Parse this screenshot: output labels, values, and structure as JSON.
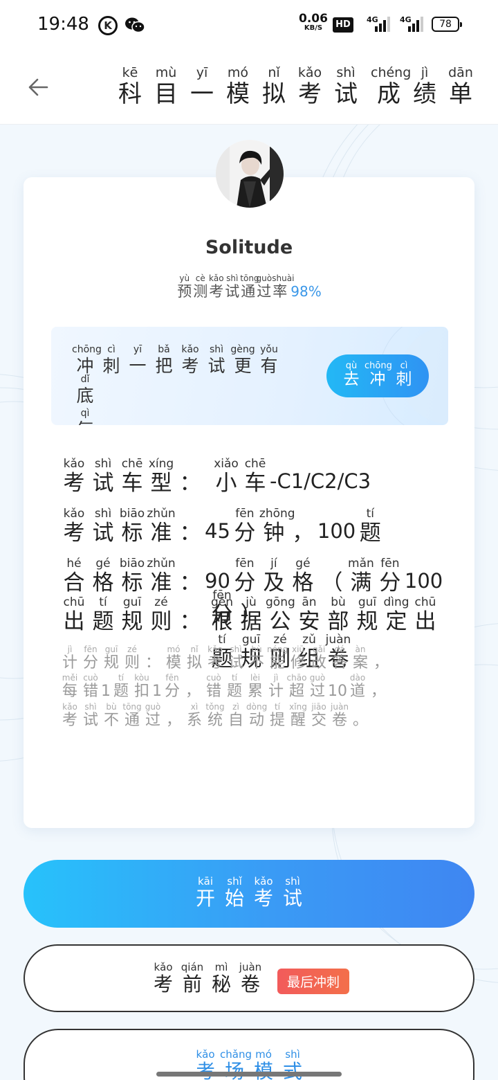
{
  "status_bar": {
    "time": "19:48",
    "speed_value": "0.06",
    "speed_unit": "KB/S",
    "hd_label": "HD",
    "signal1_label": "4G",
    "signal2_label": "4G",
    "battery": "78",
    "icons": [
      "k-icon",
      "wechat-icon",
      "signal-icon",
      "battery-icon"
    ]
  },
  "header": {
    "back_icon": "arrow-left-icon",
    "title": [
      {
        "c": "科",
        "p": "kē"
      },
      {
        "c": "目",
        "p": "mù"
      },
      {
        "c": "一",
        "p": "yī"
      },
      {
        "c": "模",
        "p": "mó"
      },
      {
        "c": "拟",
        "p": "nǐ"
      },
      {
        "c": "考",
        "p": "kǎo"
      },
      {
        "c": "试",
        "p": "shì"
      },
      {
        "c": "成",
        "p": "chéng"
      },
      {
        "c": "绩",
        "p": "jì"
      },
      {
        "c": "单",
        "p": "dān"
      }
    ]
  },
  "profile": {
    "username": "Solitude",
    "rate_label": [
      {
        "c": "预",
        "p": "yù"
      },
      {
        "c": "测",
        "p": "cè"
      },
      {
        "c": "考",
        "p": "kǎo"
      },
      {
        "c": "试",
        "p": "shì"
      },
      {
        "c": "通",
        "p": "tōng"
      },
      {
        "c": "过",
        "p": "guò"
      },
      {
        "c": "率",
        "p": "shuài"
      }
    ],
    "rate_value": "98%"
  },
  "sprint": {
    "line1": [
      {
        "c": "冲",
        "p": "chōng"
      },
      {
        "c": "刺",
        "p": "cì"
      },
      {
        "c": "一",
        "p": "yī"
      },
      {
        "c": "把",
        "p": "bǎ"
      },
      {
        "c": "考",
        "p": "kǎo"
      },
      {
        "c": "试",
        "p": "shì"
      },
      {
        "c": "更",
        "p": "gèng"
      },
      {
        "c": "有",
        "p": "yǒu"
      },
      {
        "c": "底",
        "p": "dǐ"
      }
    ],
    "line2": [
      {
        "c": "气",
        "p": "qì"
      }
    ],
    "button": [
      {
        "c": "去",
        "p": "qù"
      },
      {
        "c": "冲",
        "p": "chōng"
      },
      {
        "c": "刺",
        "p": "cì"
      }
    ]
  },
  "info": {
    "car_label": [
      {
        "c": "考",
        "p": "kǎo"
      },
      {
        "c": "试",
        "p": "shì"
      },
      {
        "c": "车",
        "p": "chē"
      },
      {
        "c": "型",
        "p": "xíng"
      },
      {
        "c": "：",
        "p": " "
      }
    ],
    "car_value": [
      {
        "c": "小",
        "p": "xiǎo"
      },
      {
        "c": "车",
        "p": "chē"
      }
    ],
    "car_value_suffix": "-C1/C2/C3",
    "standard_label": [
      {
        "c": "考",
        "p": "kǎo"
      },
      {
        "c": "试",
        "p": "shì"
      },
      {
        "c": "标",
        "p": "biāo"
      },
      {
        "c": "准",
        "p": "zhǔn"
      },
      {
        "c": "：",
        "p": " "
      }
    ],
    "standard_num1": "45",
    "standard_mid": [
      {
        "c": "分",
        "p": "fēn"
      },
      {
        "c": "钟",
        "p": "zhōng"
      },
      {
        "c": "，",
        "p": " "
      }
    ],
    "standard_num2": "100",
    "standard_end": [
      {
        "c": "题",
        "p": "tí"
      }
    ],
    "pass_label": [
      {
        "c": "合",
        "p": "hé"
      },
      {
        "c": "格",
        "p": "gé"
      },
      {
        "c": "标",
        "p": "biāo"
      },
      {
        "c": "准",
        "p": "zhǔn"
      },
      {
        "c": "：",
        "p": " "
      }
    ],
    "pass_num1": "90",
    "pass_mid": [
      {
        "c": "分",
        "p": "fēn"
      },
      {
        "c": "及",
        "p": "jí"
      },
      {
        "c": "格",
        "p": "gé"
      },
      {
        "c": "（",
        "p": " "
      },
      {
        "c": "满",
        "p": "mǎn"
      },
      {
        "c": "分",
        "p": "fēn"
      }
    ],
    "pass_num2": "100",
    "pass_cont": [
      {
        "c": "分",
        "p": "fēn"
      },
      {
        "c": "）",
        "p": " "
      }
    ],
    "rule_label": [
      {
        "c": "出",
        "p": "chū"
      },
      {
        "c": "题",
        "p": "tí"
      },
      {
        "c": "规",
        "p": "guī"
      },
      {
        "c": "则",
        "p": "zé"
      },
      {
        "c": "：",
        "p": " "
      }
    ],
    "rule_value": [
      {
        "c": "根",
        "p": "gēn"
      },
      {
        "c": "据",
        "p": "jù"
      },
      {
        "c": "公",
        "p": "gōng"
      },
      {
        "c": "安",
        "p": "ān"
      },
      {
        "c": "部",
        "p": "bù"
      },
      {
        "c": "规",
        "p": "guī"
      },
      {
        "c": "定",
        "p": "dìng"
      },
      {
        "c": "出",
        "p": "chū"
      }
    ],
    "rule_cont": [
      {
        "c": "题",
        "p": "tí"
      },
      {
        "c": "规",
        "p": "guī"
      },
      {
        "c": "则",
        "p": "zé"
      },
      {
        "c": "组",
        "p": "zǔ"
      },
      {
        "c": "卷",
        "p": "juàn"
      }
    ]
  },
  "scoring": {
    "line1": [
      {
        "c": "计",
        "p": "jì"
      },
      {
        "c": "分",
        "p": "fēn"
      },
      {
        "c": "规",
        "p": "guī"
      },
      {
        "c": "则",
        "p": "zé"
      },
      {
        "c": "：",
        "p": " "
      },
      {
        "c": "模",
        "p": "mó"
      },
      {
        "c": "拟",
        "p": "nǐ"
      },
      {
        "c": "考",
        "p": "kǎo"
      },
      {
        "c": "试",
        "p": "shì"
      },
      {
        "c": "不",
        "p": "bù"
      },
      {
        "c": "能",
        "p": "néng"
      },
      {
        "c": "修",
        "p": "xiū"
      },
      {
        "c": "改",
        "p": "gǎi"
      },
      {
        "c": "答",
        "p": "dá"
      },
      {
        "c": "案",
        "p": "àn"
      },
      {
        "c": "，",
        "p": " "
      }
    ],
    "line2a": [
      {
        "c": "每",
        "p": "měi"
      },
      {
        "c": "错",
        "p": "cuò"
      }
    ],
    "line2_num1": "1",
    "line2b": [
      {
        "c": "题",
        "p": "tí"
      },
      {
        "c": "扣",
        "p": "kòu"
      }
    ],
    "line2_num2": "1",
    "line2c": [
      {
        "c": "分",
        "p": "fēn"
      },
      {
        "c": "，",
        "p": " "
      },
      {
        "c": "错",
        "p": "cuò"
      },
      {
        "c": "题",
        "p": "tí"
      },
      {
        "c": "累",
        "p": "lèi"
      },
      {
        "c": "计",
        "p": "jì"
      },
      {
        "c": "超",
        "p": "chāo"
      },
      {
        "c": "过",
        "p": "guò"
      }
    ],
    "line2_num3": "10",
    "line2d": [
      {
        "c": "道",
        "p": "dào"
      },
      {
        "c": "，",
        "p": " "
      }
    ],
    "line3": [
      {
        "c": "考",
        "p": "kǎo"
      },
      {
        "c": "试",
        "p": "shì"
      },
      {
        "c": "不",
        "p": "bù"
      },
      {
        "c": "通",
        "p": "tōng"
      },
      {
        "c": "过",
        "p": "guò"
      },
      {
        "c": "，",
        "p": " "
      },
      {
        "c": "系",
        "p": "xì"
      },
      {
        "c": "统",
        "p": "tǒng"
      },
      {
        "c": "自",
        "p": "zì"
      },
      {
        "c": "动",
        "p": "dòng"
      },
      {
        "c": "提",
        "p": "tí"
      },
      {
        "c": "醒",
        "p": "xǐng"
      },
      {
        "c": "交",
        "p": "jiāo"
      },
      {
        "c": "卷",
        "p": "juàn"
      },
      {
        "c": "。",
        "p": " "
      }
    ]
  },
  "actions": {
    "start": [
      {
        "c": "开",
        "p": "kāi"
      },
      {
        "c": "始",
        "p": "shǐ"
      },
      {
        "c": "考",
        "p": "kǎo"
      },
      {
        "c": "试",
        "p": "shì"
      }
    ],
    "secret": [
      {
        "c": "考",
        "p": "kǎo"
      },
      {
        "c": "前",
        "p": "qián"
      },
      {
        "c": "秘",
        "p": "mì"
      },
      {
        "c": "卷",
        "p": "juàn"
      }
    ],
    "secret_badge": "最后冲刺",
    "exam_mode": [
      {
        "c": "考",
        "p": "kǎo"
      },
      {
        "c": "场",
        "p": "chǎng"
      },
      {
        "c": "模",
        "p": "mó"
      },
      {
        "c": "式",
        "p": "shì"
      }
    ]
  },
  "colors": {
    "accent": "#2f93f3",
    "badge": "#f25b5b",
    "rate": "#3a97e8"
  }
}
